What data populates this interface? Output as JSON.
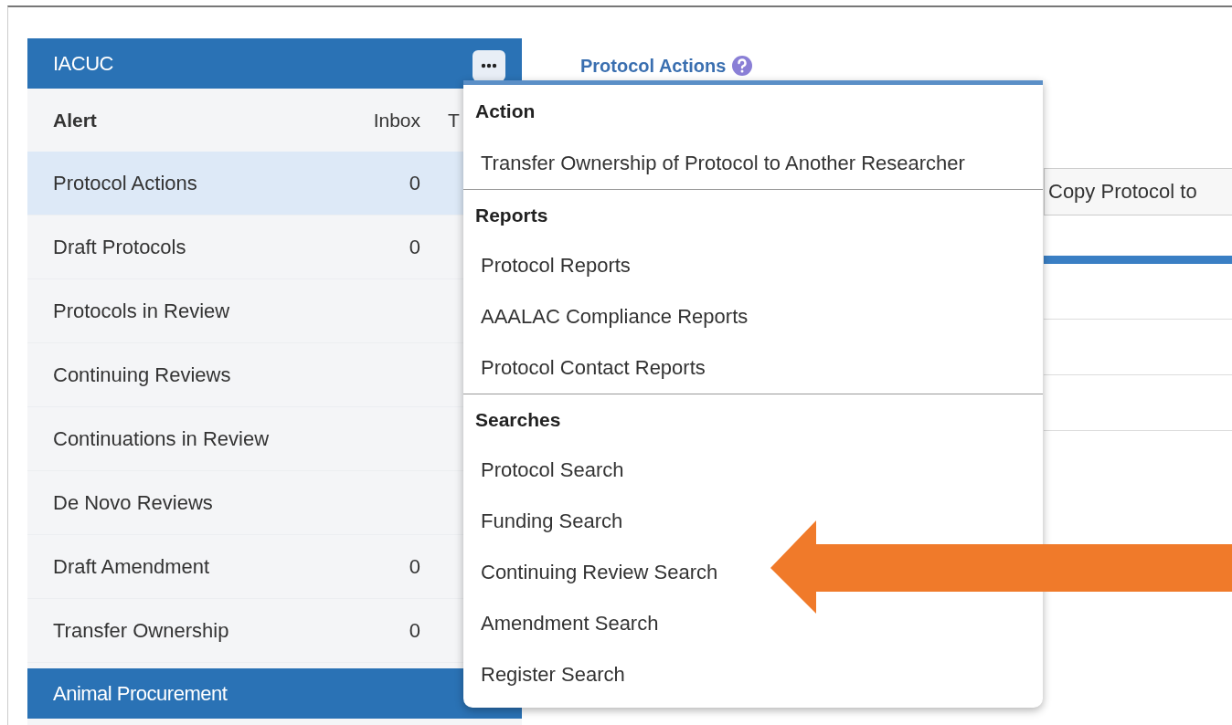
{
  "panel": {
    "title": "IACUC",
    "columns": [
      "Alert",
      "Inbox",
      "T"
    ],
    "rows": [
      {
        "label": "Protocol Actions",
        "inbox": "0",
        "selected": true
      },
      {
        "label": "Draft Protocols",
        "inbox": "0",
        "selected": false
      },
      {
        "label": "Protocols in Review",
        "selected": false
      },
      {
        "label": "Continuing Reviews",
        "selected": false
      },
      {
        "label": "Continuations in Review",
        "selected": false
      },
      {
        "label": "De Novo Reviews",
        "selected": false
      },
      {
        "label": "Draft Amendment",
        "inbox": "0",
        "selected": false
      },
      {
        "label": "Transfer Ownership",
        "inbox": "0",
        "selected": false
      }
    ],
    "next_section": "Animal Procurement"
  },
  "main": {
    "title": "Protocol Actions",
    "copy_button": "Copy Protocol to"
  },
  "menu": {
    "sections": [
      {
        "header": "Action",
        "items": [
          "Transfer Ownership of Protocol to Another Researcher"
        ]
      },
      {
        "header": "Reports",
        "items": [
          "Protocol Reports",
          "AAALAC Compliance Reports",
          "Protocol Contact Reports"
        ]
      },
      {
        "header": "Searches",
        "items": [
          "Protocol Search",
          "Funding Search",
          "Continuing Review Search",
          "Amendment Search",
          "Register Search"
        ]
      }
    ]
  }
}
